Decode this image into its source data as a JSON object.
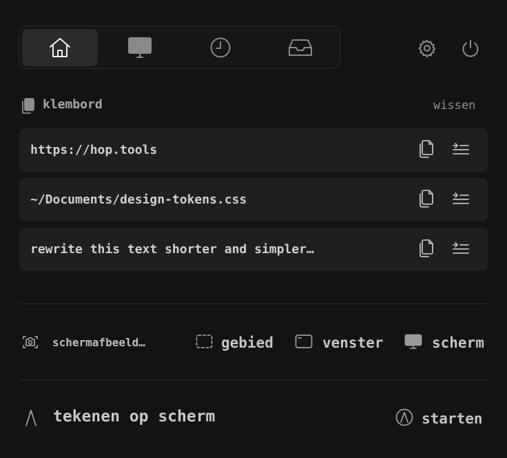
{
  "tabs": [
    {
      "name": "home",
      "icon": "home-icon"
    },
    {
      "name": "display",
      "icon": "monitor-icon"
    },
    {
      "name": "history",
      "icon": "clock-icon"
    },
    {
      "name": "inbox",
      "icon": "inbox-icon"
    }
  ],
  "active_tab": "home",
  "top_icons": [
    "gear-icon",
    "power-icon"
  ],
  "clipboard": {
    "title": "klembord",
    "clear_label": "wissen",
    "items": [
      {
        "text": "https://hop.tools"
      },
      {
        "text": "~/Documents/design-tokens.css"
      },
      {
        "text": "rewrite this text shorter and simpler…"
      }
    ]
  },
  "screenshot": {
    "label": "schermafbeeld…",
    "options": {
      "area": "gebied",
      "window": "venster",
      "screen": "scherm"
    }
  },
  "draw": {
    "label": "tekenen op scherm",
    "start_label": "starten"
  }
}
